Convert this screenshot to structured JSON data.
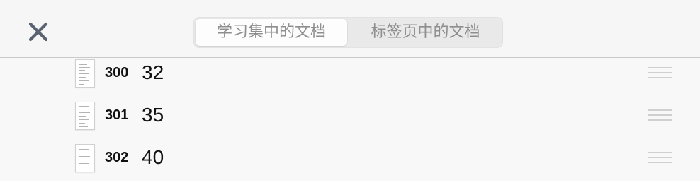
{
  "header": {
    "close_icon": "close-icon",
    "segments": [
      {
        "label": "学习集中的文档",
        "selected": true
      },
      {
        "label": "标签页中的文档",
        "selected": false
      }
    ]
  },
  "documents": [
    {
      "number": "300",
      "value": "32",
      "icon": "document-thumbnail-icon"
    },
    {
      "number": "301",
      "value": "35",
      "icon": "document-thumbnail-icon"
    },
    {
      "number": "302",
      "value": "40",
      "icon": "document-thumbnail-icon"
    }
  ],
  "colors": {
    "header_bg": "#f6f6f6",
    "list_bg": "#f8f8f8",
    "segment_text": "#8e8e8e",
    "close_icon": "#5b6370",
    "drag_handle": "#cfcfcf"
  }
}
